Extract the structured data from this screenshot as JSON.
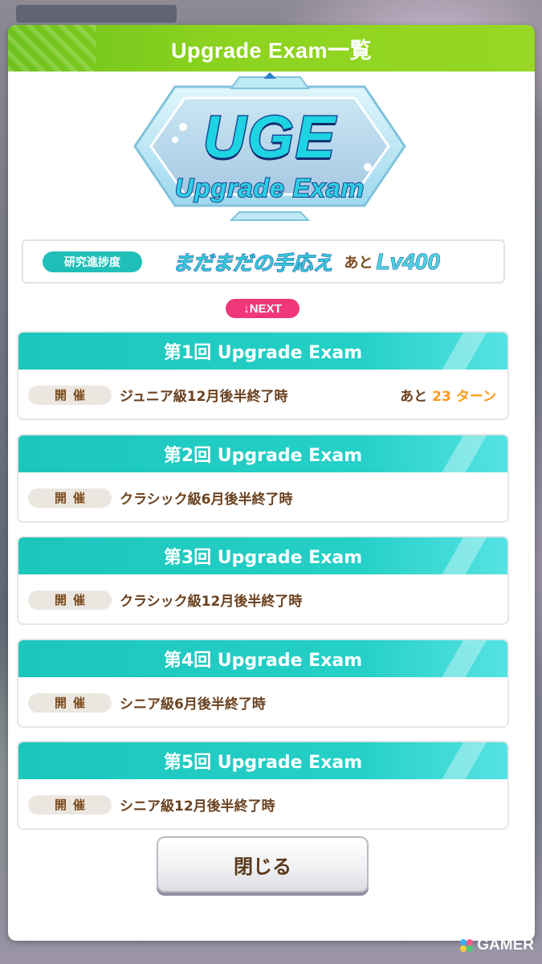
{
  "dialog": {
    "title": "Upgrade Exam一覧"
  },
  "logo": {
    "big_text": "UGE",
    "small_text": "Upgrade Exam"
  },
  "progress": {
    "label": "研究進捗度",
    "value": "まだまだの手応え",
    "remain_prefix": "あと",
    "remain_value": "Lv400"
  },
  "next_badge": "↓NEXT",
  "exams": [
    {
      "title": "第1回 Upgrade Exam",
      "held_label": "開催",
      "held_text": "ジュニア級12月後半終了時",
      "turns_prefix": "あと",
      "turns_value": "23",
      "turns_unit": "ターン"
    },
    {
      "title": "第2回 Upgrade Exam",
      "held_label": "開催",
      "held_text": "クラシック級6月後半終了時"
    },
    {
      "title": "第3回 Upgrade Exam",
      "held_label": "開催",
      "held_text": "クラシック級12月後半終了時"
    },
    {
      "title": "第4回 Upgrade Exam",
      "held_label": "開催",
      "held_text": "シニア級6月後半終了時"
    },
    {
      "title": "第5回 Upgrade Exam",
      "held_label": "開催",
      "held_text": "シニア級12月後半終了時"
    }
  ],
  "close_button": "閉じる",
  "watermark": "GAMER",
  "colors": {
    "header_green": "#8cd31f",
    "exam_teal": "#25d0c7",
    "accent_orange": "#ff9a1a",
    "next_pink": "#f0377a",
    "text_brown": "#6b4220"
  }
}
